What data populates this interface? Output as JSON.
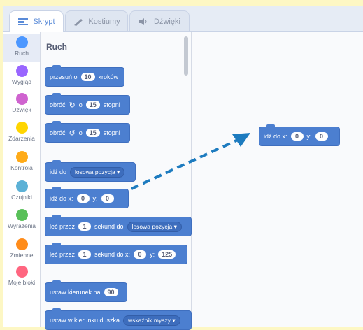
{
  "tabs": [
    {
      "label": "Skrypt",
      "icon": "code-icon",
      "active": true
    },
    {
      "label": "Kostiumy",
      "icon": "brush-icon",
      "active": false
    },
    {
      "label": "Dźwięki",
      "icon": "speaker-icon",
      "active": false
    }
  ],
  "categories": [
    {
      "label": "Ruch",
      "color": "#4c97ff"
    },
    {
      "label": "Wygląd",
      "color": "#9966ff"
    },
    {
      "label": "Dźwięk",
      "color": "#cf63cf"
    },
    {
      "label": "Zdarzenia",
      "color": "#ffd500"
    },
    {
      "label": "Kontrola",
      "color": "#ffab19"
    },
    {
      "label": "Czujniki",
      "color": "#5cb1d6"
    },
    {
      "label": "Wyrażenia",
      "color": "#59c059"
    },
    {
      "label": "Zmienne",
      "color": "#ff8c1a"
    },
    {
      "label": "Moje bloki",
      "color": "#ff6680"
    }
  ],
  "palette": {
    "title": "Ruch",
    "blocks": {
      "move": {
        "text1": "przesuń o",
        "val": "10",
        "text2": "kroków"
      },
      "turn_right": {
        "text1": "obróć",
        "text2": "o",
        "val": "15",
        "text3": "stopni"
      },
      "turn_left": {
        "text1": "obróć",
        "text2": "o",
        "val": "15",
        "text3": "stopni"
      },
      "goto": {
        "text1": "idź do",
        "dropdown": "losowa pozycja ▾"
      },
      "goto_xy": {
        "text1": "idź do x:",
        "x": "0",
        "text2": "y:",
        "y": "0"
      },
      "glide_to": {
        "text1": "leć przez",
        "val": "1",
        "text2": "sekund do",
        "dropdown": "losowa pozycja ▾"
      },
      "glide_xy": {
        "text1": "leć przez",
        "val": "1",
        "text2": "sekund do x:",
        "x": "0",
        "text3": "y:",
        "y": "125"
      },
      "point_dir": {
        "text1": "ustaw kierunek na",
        "val": "90"
      },
      "point_towards": {
        "text1": "ustaw w kierunku duszka",
        "dropdown": "wskaźnik myszy ▾"
      }
    }
  },
  "script": {
    "goto_xy": {
      "text1": "idź do x:",
      "x": "0",
      "text2": "y:",
      "y": "0"
    }
  },
  "colors": {
    "motion": "#4c7fd0",
    "arrow": "#1d7bbf"
  }
}
